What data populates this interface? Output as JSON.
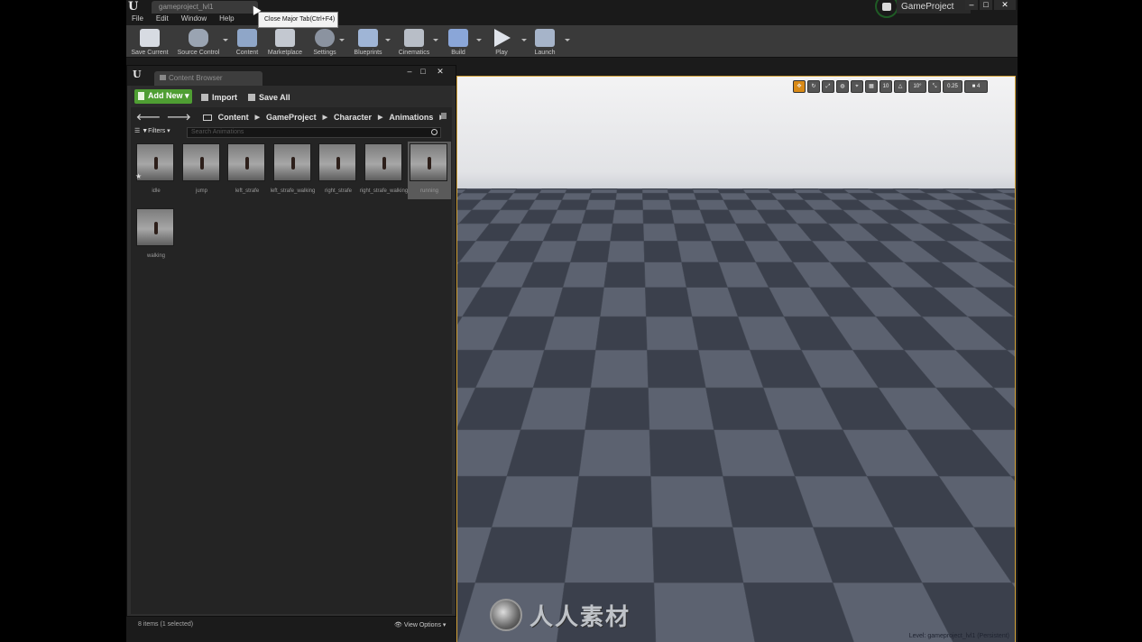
{
  "title_bar": {
    "level_tab": "gameproject_lvl1",
    "tooltip": "Close Major Tab(Ctrl+F4)",
    "menu": [
      "File",
      "Edit",
      "Window",
      "Help"
    ],
    "project_name": "GameProject",
    "window_controls": [
      "–",
      "□",
      "✕"
    ]
  },
  "toolbar": {
    "buttons": [
      {
        "label": "Save Current",
        "icon": "save-icon"
      },
      {
        "label": "Source Control",
        "icon": "source-control-icon"
      },
      {
        "label": "Content",
        "icon": "content-icon"
      },
      {
        "label": "Marketplace",
        "icon": "marketplace-icon"
      },
      {
        "label": "Settings",
        "icon": "settings-icon"
      },
      {
        "label": "Blueprints",
        "icon": "blueprints-icon"
      },
      {
        "label": "Cinematics",
        "icon": "cinematics-icon"
      },
      {
        "label": "Build",
        "icon": "build-icon"
      },
      {
        "label": "Play",
        "icon": "play-icon"
      },
      {
        "label": "Launch",
        "icon": "launch-icon"
      }
    ]
  },
  "content_browser": {
    "tab_title": "Content Browser",
    "window_controls": [
      "–",
      "□",
      "✕"
    ],
    "add_new": "Add New",
    "import": "Import",
    "save_all": "Save All",
    "breadcrumb": [
      "Content",
      "GameProject",
      "Character",
      "Animations"
    ],
    "filters": "Filters",
    "search_placeholder": "Search Animations",
    "assets": [
      {
        "name": "idle",
        "selected": false
      },
      {
        "name": "jump",
        "selected": false
      },
      {
        "name": "left_strafe",
        "selected": false
      },
      {
        "name": "left_strafe_walking",
        "selected": false
      },
      {
        "name": "right_strafe",
        "selected": false
      },
      {
        "name": "right_strafe_walking",
        "selected": false
      },
      {
        "name": "running",
        "selected": true
      },
      {
        "name": "walking",
        "selected": false
      }
    ],
    "status": "8 items (1 selected)",
    "view_options": "View Options"
  },
  "viewport": {
    "tools": [
      "move",
      "rotate",
      "scale",
      "world",
      "surface",
      "grid",
      "10",
      "angle",
      "10°",
      "scale",
      "0.25",
      "camera"
    ],
    "level_text": "Level:  gameproject_lvl1 (Persistent)",
    "watermark": "人人素材"
  },
  "colors": {
    "accent_green": "#4f9e33",
    "selection_orange": "#d98a17",
    "viewport_border": "#d2a23a"
  }
}
